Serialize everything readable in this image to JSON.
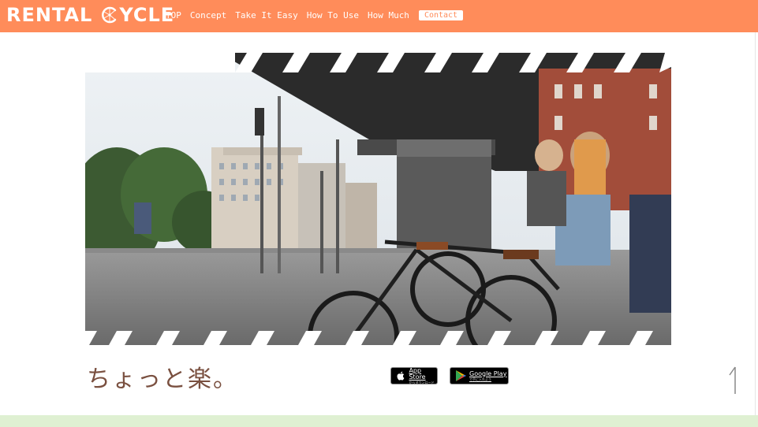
{
  "header": {
    "logo_part1": "RENTAL",
    "logo_part2_pre": "",
    "logo_part2_post": "YCLE",
    "logo_wheel_icon": "bicycle-wheel-icon",
    "bg_color": "#ff8c5a"
  },
  "nav": {
    "items": [
      "TOP",
      "Concept",
      "Take It Easy",
      "How To Use",
      "How Much"
    ],
    "contact_label": "Contact"
  },
  "hero": {
    "image_icon": "city-bicycles-photo",
    "border_style": "diagonal-stripes"
  },
  "tagline": "ちょっと楽。",
  "stores": {
    "appstore_title": "App Store",
    "appstore_sub": "からダウンロード",
    "appstore_icon": "apple-icon",
    "gplay_title": "Google Play",
    "gplay_sub": "で手に入れよう",
    "gplay_icon": "google-play-icon"
  },
  "scroll_top_icon": "arrow-up-icon",
  "colors": {
    "accent": "#ff8c5a",
    "tagline": "#7a5040",
    "footer": "#dff0d2"
  }
}
